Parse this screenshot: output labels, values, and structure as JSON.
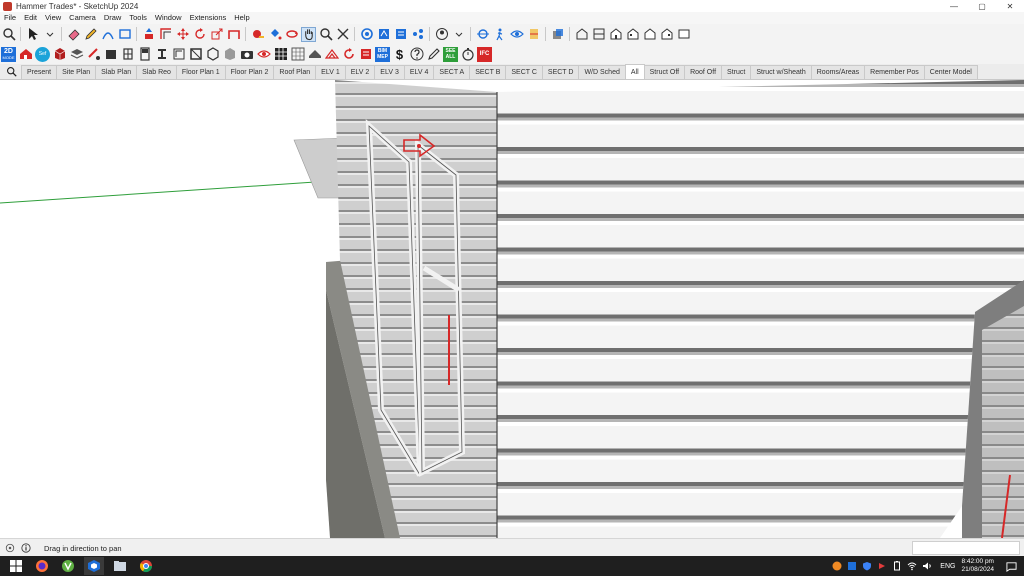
{
  "window": {
    "title": "Hammer Trades* - SketchUp 2024",
    "minimize": "—",
    "maximize": "▢",
    "close": "✕"
  },
  "menu": [
    "File",
    "Edit",
    "View",
    "Camera",
    "Draw",
    "Tools",
    "Window",
    "Extensions",
    "Help"
  ],
  "toolbar2_labels": {
    "twod": "2D",
    "mode": "MODE",
    "sefaira": "Sef",
    "bim": "BIM",
    "mep": "MEP",
    "see": "SEE",
    "all": "ALL",
    "ifc": "IFC",
    "dollar": "$"
  },
  "scenes": {
    "tabs": [
      "Present",
      "Site Plan",
      "Slab Plan",
      "Slab Reo",
      "Floor Plan 1",
      "Floor Plan 2",
      "Roof Plan",
      "ELV 1",
      "ELV 2",
      "ELV 3",
      "ELV 4",
      "SECT A",
      "SECT B",
      "SECT C",
      "SECT D",
      "W/D Sched",
      "All",
      "Struct Off",
      "Roof Off",
      "Struct",
      "Struct w/Sheath",
      "Rooms/Areas",
      "Remember Pos",
      "Center Model"
    ],
    "active": "All"
  },
  "status": {
    "text": "Drag in direction to pan"
  },
  "tray": {
    "language": "ENG",
    "time": "8:42:00 pm",
    "date": "21/08/2024"
  },
  "colors": {
    "accent": "#1e6fd9",
    "selected_tab": "#ffffff",
    "siding": "#e6e6e6",
    "axis_green": "#2e9e3a",
    "move_arrow": "#d62828"
  }
}
